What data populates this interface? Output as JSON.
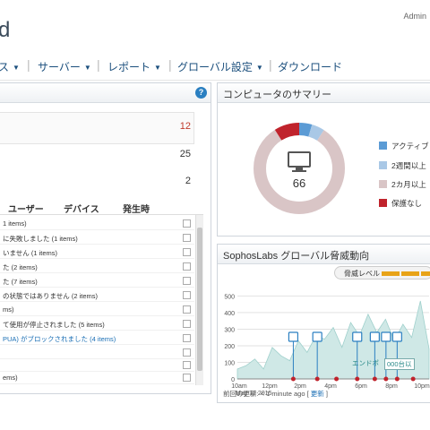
{
  "header": {
    "title_fragment": "d",
    "user_fragment": "Admin"
  },
  "nav": {
    "items": [
      {
        "label": "ス",
        "caret": "▼"
      },
      {
        "label": "サーバー",
        "caret": "▼"
      },
      {
        "label": "レポート",
        "caret": "▼"
      },
      {
        "label": "グローバル設定",
        "caret": "▼"
      },
      {
        "label": "ダウンロード",
        "caret": ""
      }
    ],
    "separator": "|"
  },
  "alerts_panel": {
    "help": "?",
    "summary_counts": [
      "12",
      "25",
      "2"
    ],
    "columns": [
      "ユーザー",
      "デバイス",
      "発生時"
    ],
    "rows": [
      "1 items)",
      "に失敗しました (1 items)",
      "いません (1 items)",
      "た (2 items)",
      "た (7 items)",
      "の状態ではありません (2 items)",
      "ms)",
      "て使用が停止されました (5 items)",
      "PUA) がブロックされました (4 items)",
      "",
      "",
      "ems)"
    ]
  },
  "computer_summary": {
    "title": "コンピュータのサマリー",
    "center_value": "66",
    "legend": [
      "アクティブ",
      "2週間以上",
      "2カ月以上",
      "保護なし"
    ],
    "colors": {
      "active": "#5b9bd5",
      "two_weeks": "#a9c8e6",
      "two_months": "#d9c5c6",
      "unprotected": "#c0232c"
    }
  },
  "threat_panel": {
    "title": "SophosLabs グローバル脅威動向",
    "threat_level_label": "脅威レベル",
    "footer_label": "前回の更新: < 1 minute ago [",
    "footer_link": "更新",
    "footer_end": "]",
    "chart_annotations": [
      "エンドポ",
      "000台以"
    ]
  },
  "chart_data": {
    "type": "area",
    "x_labels": [
      "10am\nMay 12 2015",
      "12pm",
      "2pm",
      "4pm",
      "6pm",
      "8pm",
      "10pm"
    ],
    "x_tick_top": [
      "10am",
      "12pm",
      "2pm",
      "4pm",
      "6pm",
      "8pm",
      "10pm"
    ],
    "x_tick_bottom": [
      "May 12 2015",
      "",
      "",
      "",
      "",
      "",
      ""
    ],
    "y_ticks": [
      0,
      100,
      200,
      300,
      400,
      500
    ],
    "ylim": [
      0,
      540
    ],
    "values": [
      60,
      80,
      120,
      60,
      190,
      140,
      110,
      230,
      160,
      260,
      240,
      310,
      190,
      340,
      260,
      390,
      280,
      360,
      230,
      330,
      250,
      470,
      180
    ],
    "donut": {
      "center_value": 66,
      "slices": [
        {
          "label": "アクティブ",
          "value": 3
        },
        {
          "label": "2週間以上",
          "value": 3
        },
        {
          "label": "2カ月以上",
          "value": 54
        },
        {
          "label": "保護なし",
          "value": 6
        }
      ]
    },
    "markers_x": [
      3.5,
      5.0,
      7.5,
      8.6,
      9.3,
      10.0
    ]
  }
}
